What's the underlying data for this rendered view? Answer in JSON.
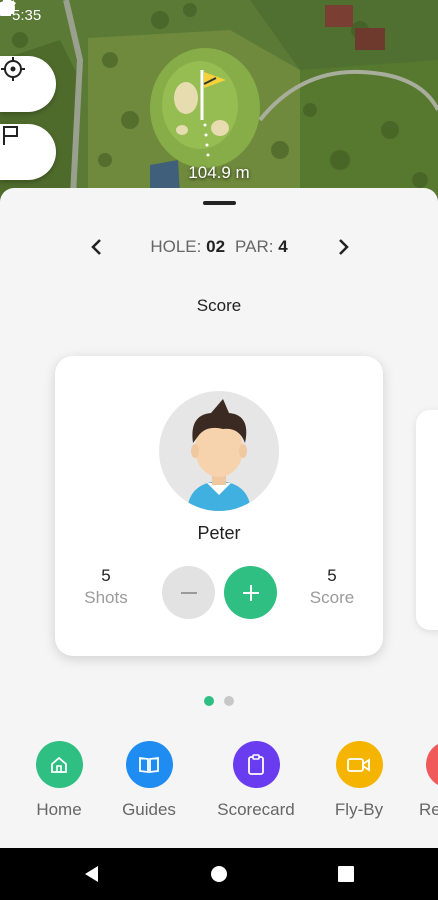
{
  "status_bar": {
    "time": "5:35",
    "icons": [
      "app-notification-icon",
      "sim-icon",
      "wifi-icon",
      "signal-icon",
      "battery-icon"
    ]
  },
  "map": {
    "distance": "104.9 m",
    "buttons": [
      "crosshair-icon",
      "flag-icon"
    ]
  },
  "hole": {
    "hole_label": "HOLE:",
    "hole_number": "02",
    "par_label": "PAR:",
    "par_value": "4"
  },
  "section_title": "Score",
  "player": {
    "name": "Peter",
    "shots_value": "5",
    "shots_label": "Shots",
    "score_value": "5",
    "score_label": "Score"
  },
  "pager": {
    "pages": 2,
    "active": 0
  },
  "bottom_nav": [
    {
      "label": "Home",
      "icon": "home-icon",
      "color": "#2fbf82"
    },
    {
      "label": "Guides",
      "icon": "book-icon",
      "color": "#1e8cf0"
    },
    {
      "label": "Scorecard",
      "icon": "clipboard-icon",
      "color": "#6a3cf0"
    },
    {
      "label": "Fly-By",
      "icon": "video-icon",
      "color": "#f5b400"
    },
    {
      "label": "Re",
      "icon": "red-icon",
      "color": "#f05a5a"
    }
  ],
  "colors": {
    "accent": "#2fbf82",
    "sheet_background": "#f5f5f5",
    "minus_button": "#e2e2e2"
  }
}
